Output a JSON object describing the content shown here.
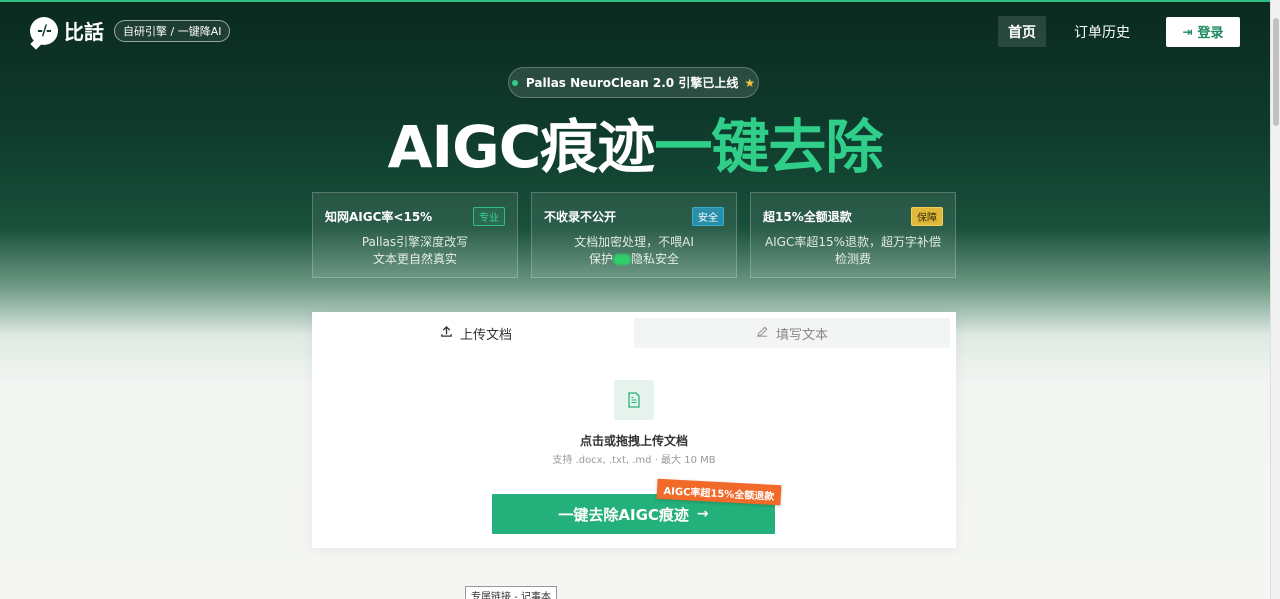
{
  "header": {
    "logo_mark": "-/-",
    "logo_text": "比話",
    "badge": "自研引擎 / 一键降AI",
    "nav": {
      "home": "首页",
      "history": "订单历史",
      "login": "登录"
    }
  },
  "announcement": {
    "text": "Pallas NeuroClean 2.0 引擎已上线",
    "star": "★"
  },
  "hero": {
    "white": "AIGC痕迹",
    "green": "一键去除"
  },
  "features": [
    {
      "title": "知网AIGC率<15%",
      "tag": "专业",
      "line1": "Pallas引擎深度改写",
      "line2": "文本更自然真实"
    },
    {
      "title": "不收录不公开",
      "tag": "安全",
      "line1": "文档加密处理，不喂AI",
      "line2a": "保护",
      "line2b": "隐私安全"
    },
    {
      "title": "超15%全额退款",
      "tag": "保障",
      "line1": "AIGC率超15%退款，超万字补偿",
      "line2": "检测费"
    }
  ],
  "upload": {
    "tab_upload": "上传文档",
    "tab_write": "填写文本",
    "drop_title": "点击或拖拽上传文档",
    "drop_sub": "支持 .docx, .txt, .md · 最大 10 MB",
    "cta": "一键去除AIGC痕迹",
    "ribbon": "AIGC率超15%全额退款"
  },
  "tooltip": "专属链接 - 记事本",
  "colors": {
    "accent": "#2fcf8a",
    "cta": "#24b07a",
    "ribbon": "#f26a2a",
    "dark_bg": "#0f3b2c"
  }
}
